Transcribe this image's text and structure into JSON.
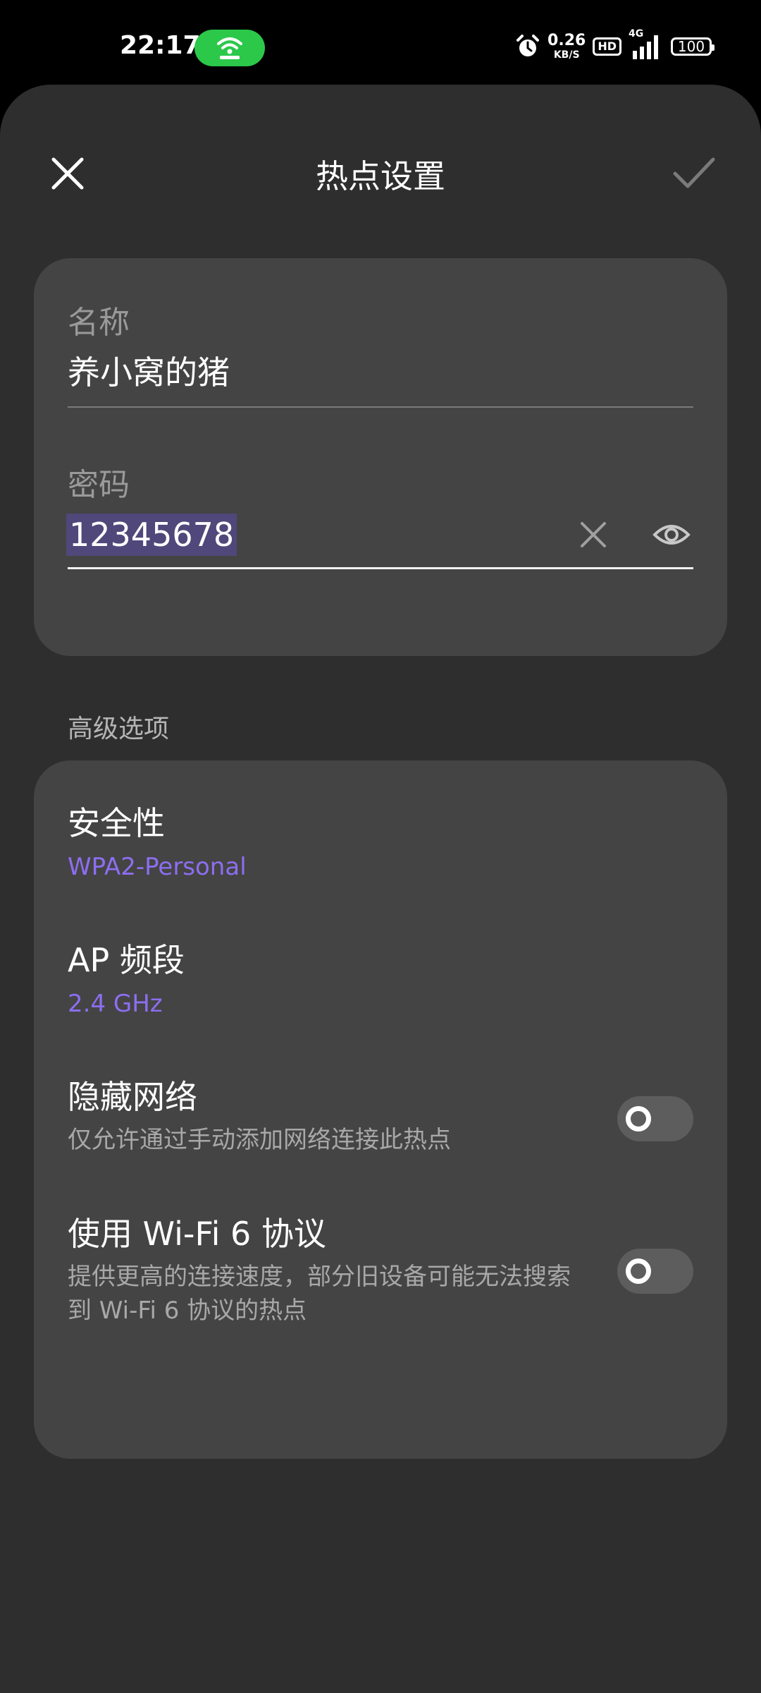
{
  "status_bar": {
    "time": "22:17",
    "speed_value": "0.26",
    "speed_unit": "KB/S",
    "hd_label": "HD",
    "network_label": "4G",
    "battery": "100"
  },
  "header": {
    "title": "热点设置"
  },
  "network_card": {
    "name_label": "名称",
    "name_value": "养小窝的猪",
    "password_label": "密码",
    "password_value": "12345678"
  },
  "advanced": {
    "section_label": "高级选项",
    "security_title": "安全性",
    "security_value": "WPA2-Personal",
    "band_title": "AP 频段",
    "band_value": "2.4 GHz",
    "hide_title": "隐藏网络",
    "hide_desc": "仅允许通过手动添加网络连接此热点",
    "hide_enabled": false,
    "wifi6_title": "使用 Wi-Fi 6 协议",
    "wifi6_desc": "提供更高的连接速度，部分旧设备可能无法搜索到 Wi-Fi 6 协议的热点",
    "wifi6_enabled": false
  },
  "colors": {
    "background": "#2e2e2e",
    "card": "#444444",
    "accent": "#8d6ef0",
    "hotspot_pill": "#2cc84a"
  }
}
